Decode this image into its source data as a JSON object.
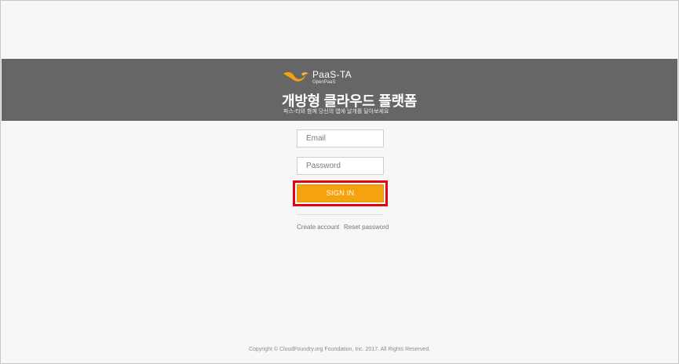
{
  "brand": {
    "logo_name": "PaaS-TA",
    "logo_sub": "OpenPaaS",
    "logo_color": "#f5a20f",
    "title": "개방형 클라우드 플랫폼",
    "subtitle": "파스-타와 함께 당신의 앱에 날개를 달아보세요"
  },
  "form": {
    "email_placeholder": "Email",
    "password_placeholder": "Password",
    "signin_label": "SIGN IN",
    "accent": "#f5a20f",
    "highlight_color": "#e60012"
  },
  "links": {
    "create_account": "Create account",
    "reset_password": "Reset password"
  },
  "footer": {
    "copyright": "Copyright © CloudFoundry.org Foundation, Inc. 2017. All Rights Reserved."
  }
}
